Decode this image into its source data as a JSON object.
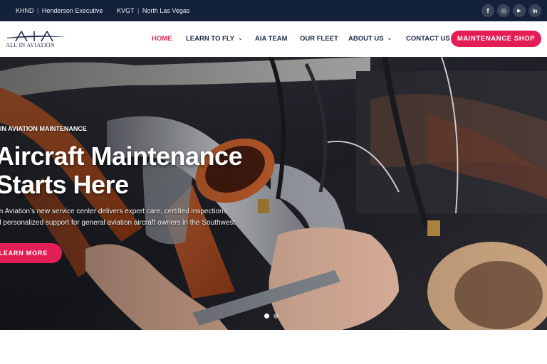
{
  "topbar": {
    "airports": [
      {
        "code": "KHND",
        "name": "Henderson Executive"
      },
      {
        "code": "KVGT",
        "name": "North Las Vegas"
      }
    ],
    "socials": [
      {
        "icon": "facebook-icon",
        "glyph": "f"
      },
      {
        "icon": "instagram-icon",
        "glyph": "◎"
      },
      {
        "icon": "youtube-icon",
        "glyph": "▶"
      },
      {
        "icon": "linkedin-icon",
        "glyph": "in"
      }
    ]
  },
  "header": {
    "logo_text": "ALL IN AVIATION",
    "nav": [
      {
        "label": "HOME",
        "active": true,
        "dropdown": false
      },
      {
        "label": "LEARN TO FLY",
        "active": false,
        "dropdown": true
      },
      {
        "label": "AIA TEAM",
        "active": false,
        "dropdown": false
      },
      {
        "label": "OUR FLEET",
        "active": false,
        "dropdown": false
      },
      {
        "label": "ABOUT US",
        "active": false,
        "dropdown": true
      },
      {
        "label": "CONTACT US",
        "active": false,
        "dropdown": false
      }
    ],
    "shop_label": "MAINTENANCE SHOP"
  },
  "hero": {
    "eyebrow": "IN AVIATION MAINTENANCE",
    "headline_1": "Aircraft Maintenance",
    "headline_2": "Starts Here",
    "desc_1": "In Aviation’s new service center delivers expert care, certified inspections,",
    "desc_2": "d personalized support for general aviation aircraft owners in the Southwest.",
    "cta_label": "LEARN MORE",
    "slides_total": 2,
    "slide_active": 1
  },
  "colors": {
    "topbar_bg": "#14213a",
    "accent": "#e21e54",
    "nav_text": "#1d2a4a"
  }
}
